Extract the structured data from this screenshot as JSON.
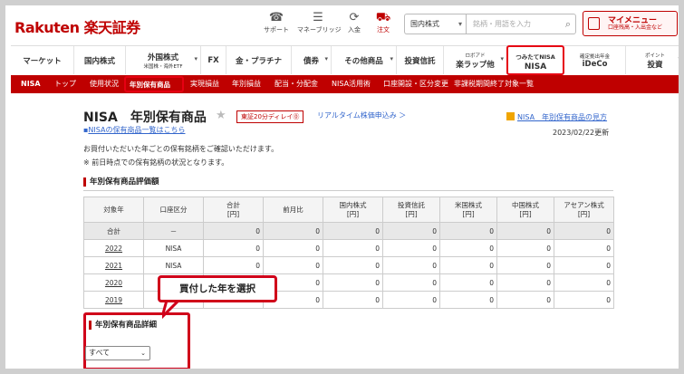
{
  "header": {
    "logo": "Rakuten 楽天証券",
    "icons": [
      {
        "name": "support",
        "label": "サポート",
        "glyph": "☎"
      },
      {
        "name": "manebridge",
        "label": "マネーブリッジ",
        "glyph": "☰"
      },
      {
        "name": "deposit",
        "label": "入金",
        "glyph": "⟳"
      },
      {
        "name": "order",
        "label": "注文",
        "glyph": "⛟"
      }
    ],
    "search_category": "国内株式",
    "search_placeholder": "銘柄・用語を入力",
    "mymenu_title": "マイメニュー",
    "mymenu_sub": "口座残高・入出金など"
  },
  "nav": {
    "items": [
      {
        "label": "マーケット",
        "sub": ""
      },
      {
        "label": "国内株式",
        "sub": ""
      },
      {
        "label": "外国株式",
        "sub": "米国株・海外ETF"
      },
      {
        "label": "FX",
        "sub": ""
      },
      {
        "label": "金・プラチナ",
        "sub": ""
      },
      {
        "label": "債券",
        "sub": ""
      },
      {
        "label": "その他商品",
        "sub": ""
      },
      {
        "label": "投資信託",
        "sub": ""
      },
      {
        "label": "楽ラップ他",
        "sub": "ロボアド"
      },
      {
        "label": "NISA",
        "sub": "つみたてNISA"
      },
      {
        "label": "iDeCo",
        "sub": "確定拠出年金"
      },
      {
        "label": "投資",
        "sub": "ポイント"
      }
    ]
  },
  "subnav": {
    "items": [
      "NISA",
      "トップ",
      "使用状況",
      "年別保有商品",
      "実現損益",
      "年別損益",
      "配当・分配金",
      "NISA活用術",
      "口座開設・区分変更",
      "非課税期間終了対象一覧"
    ]
  },
  "page": {
    "title": "NISA　年別保有商品",
    "badge": "東証20分ディレイ⓪",
    "realtime_link": "リアルタイム株価申込み ＞",
    "list_link": "NISAの保有商品一覧はこちら",
    "help_link": "NISA　年別保有商品の見方",
    "updated": "2023/02/22更新",
    "description": "お買付いただいた年ごとの保有銘柄をご確認いただけます。",
    "note": "※ 前日時点での保有銘柄の状況となります。",
    "eval_heading": "年別保有商品評価額",
    "detail_heading": "年別保有商品詳細",
    "dropdown_value": "すべて",
    "callout": "買付した年を選択"
  },
  "table": {
    "headers": [
      "対象年",
      "口座区分",
      "合計\n[円]",
      "前月比",
      "国内株式\n[円]",
      "投資信託\n[円]",
      "米国株式\n[円]",
      "中国株式\n[円]",
      "アセアン株式\n[円]"
    ],
    "rows": [
      [
        "合計",
        "－",
        "0",
        "0",
        "0",
        "0",
        "0",
        "0",
        "0"
      ],
      [
        "2022",
        "NISA",
        "0",
        "0",
        "0",
        "0",
        "0",
        "0",
        "0"
      ],
      [
        "2021",
        "NISA",
        "0",
        "0",
        "0",
        "0",
        "0",
        "0",
        "0"
      ],
      [
        "2020",
        "",
        "",
        "0",
        "0",
        "0",
        "0",
        "0",
        "0"
      ],
      [
        "2019",
        "",
        "",
        "0",
        "0",
        "0",
        "0",
        "0",
        "0"
      ]
    ]
  }
}
